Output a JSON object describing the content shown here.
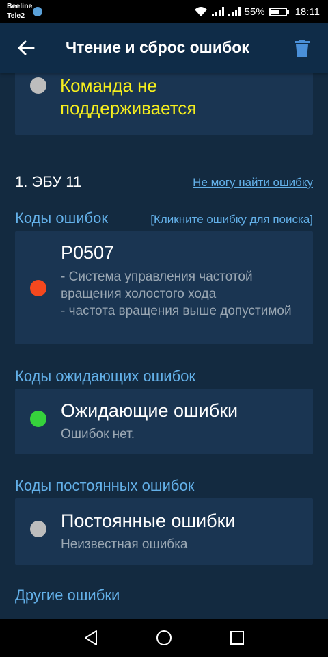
{
  "status_bar": {
    "carrier_1": "Beeline",
    "carrier_2": "Tele2",
    "battery": "55%",
    "time": "18:11"
  },
  "app_bar": {
    "title": "Чтение и сброс ошибок",
    "back_icon": "arrow-left-icon",
    "delete_icon": "trash-icon"
  },
  "unsupported_card": {
    "text": "Команда не поддерживается",
    "status_color": "#bdbdbd",
    "text_color": "#f5ee1e"
  },
  "ecu": {
    "label": "1. ЭБУ 11",
    "link": "Не могу найти ошибку"
  },
  "error_codes": {
    "header": "Коды ошибок",
    "hint": "[Кликните ошибку для поиска]",
    "items": [
      {
        "code": "P0507",
        "description": " - Система управления частотой вращения холостого хода\n- частота вращения выше допустимой",
        "status_color": "#f4481e"
      }
    ]
  },
  "pending_codes": {
    "header": "Коды ожидающих ошибок",
    "title": "Ожидающие ошибки",
    "subtitle": "Ошибок нет.",
    "status_color": "#36d23c"
  },
  "permanent_codes": {
    "header": "Коды постоянных ошибок",
    "title": "Постоянные ошибки",
    "subtitle": "Неизвестная ошибка",
    "status_color": "#bdbdbd"
  },
  "other_errors": {
    "header": "Другие ошибки"
  },
  "colors": {
    "background": "#132a40",
    "card": "#1a3552",
    "accent": "#63b0e8"
  }
}
